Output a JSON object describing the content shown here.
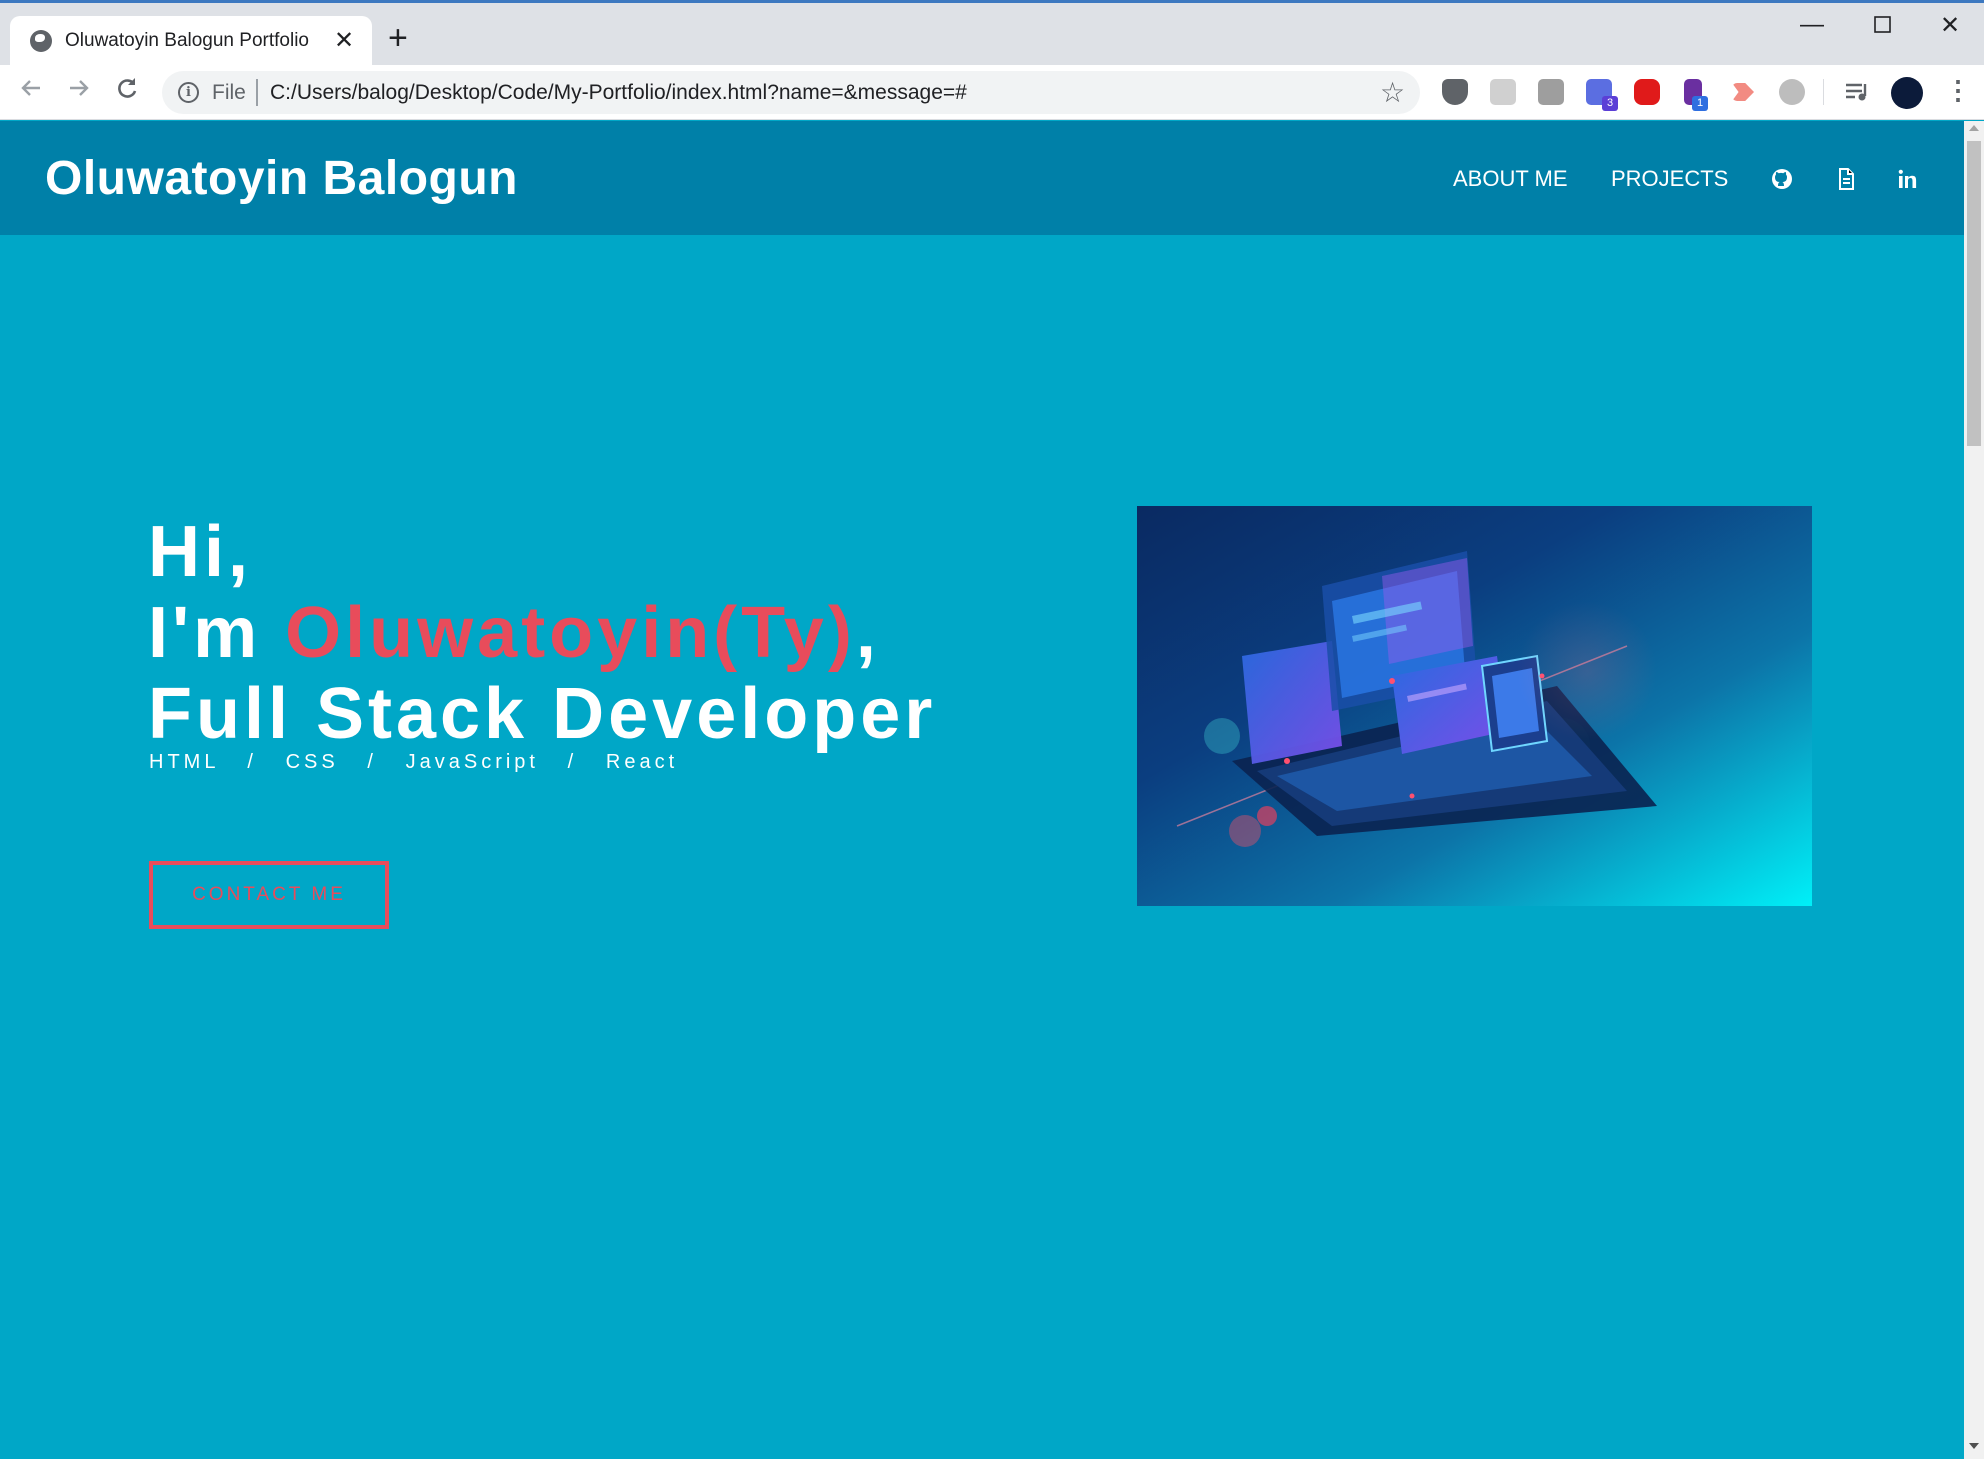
{
  "browser": {
    "tab_title": "Oluwatoyin Balogun Portfolio",
    "url_scheme": "File",
    "url": "C:/Users/balog/Desktop/Code/My-Portfolio/index.html?name=&message=#",
    "extension_badges": [
      "3",
      "1"
    ]
  },
  "header": {
    "brand": "Oluwatoyin Balogun",
    "nav": [
      "ABOUT ME",
      "PROJECTS"
    ],
    "icons": [
      "github-icon",
      "document-icon",
      "linkedin-icon"
    ]
  },
  "hero": {
    "greeting": "Hi,",
    "intro_prefix": "I'm ",
    "name": "Oluwatoyin(Ty)",
    "intro_suffix": ",",
    "role": "Full Stack Developer",
    "skills": "HTML   /   CSS   /   JavaScript   /   React",
    "contact_button": "CONTACT ME"
  },
  "colors": {
    "header_bg": "#0080a8",
    "hero_bg": "#00a7c7",
    "accent": "#e84c5b",
    "text": "#ffffff"
  }
}
